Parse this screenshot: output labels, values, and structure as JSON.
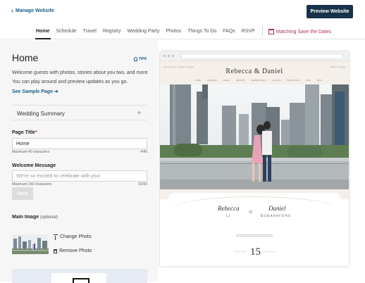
{
  "header": {
    "back_label": "Manage Website",
    "preview_label": "Preview Website"
  },
  "nav": {
    "items": [
      "Home",
      "Schedule",
      "Travel",
      "Registry",
      "Wedding Party",
      "Photos",
      "Things To Do",
      "FAQs",
      "RSVP"
    ],
    "active": "Home",
    "save_dates_label": "Matching Save the Dates"
  },
  "editor": {
    "page_title": "Home",
    "tips_label": "TIPS",
    "intro_text": "Welcome guests with photos, stories about you two, and more. You can play around and preview updates as you go.",
    "sample_link": "See Sample Page",
    "summary_label": "Wedding Summary",
    "page_title_label": "Page Title",
    "page_title_value": "Home",
    "page_title_hint": "Maximum 40 characters",
    "page_title_count": "4/40",
    "welcome_label": "Welcome Message",
    "welcome_placeholder": "We're so excited to celebrate with you!",
    "welcome_hint": "Maximum 150 characters",
    "welcome_count": "0/150",
    "save_label": "Save",
    "main_image_label": "Main Image",
    "main_image_optional": "(optional)",
    "change_photo_label": "Change Photo",
    "remove_photo_label": "Remove Photo"
  },
  "preview": {
    "site_title": "Rebecca & Daniel",
    "meta_left": "April 15, 2023 · Atlanta, Georgia",
    "meta_right": "Atlanta, Georgia",
    "site_nav": [
      "HOME",
      "SCHEDULE",
      "TRAVEL",
      "REGISTRY",
      "WEDDING PARTY",
      "PHOTOS",
      "THINGS TO DO",
      "FAQS",
      "RSVP"
    ],
    "name1": "Rebecca",
    "name2": "Daniel",
    "surname1": "LI",
    "surname2": "BURAPAVONG",
    "ampersand": "&",
    "day": "15"
  },
  "colors": {
    "primary_dark": "#17324a",
    "link_blue": "#1b5e8c",
    "accent_red": "#b0304a"
  }
}
